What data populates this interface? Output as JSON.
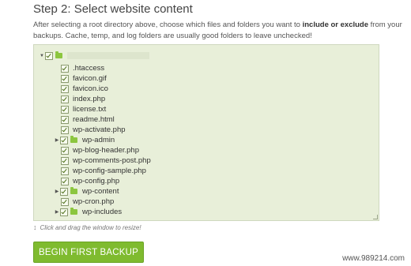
{
  "heading": "Step 2: Select website content",
  "description": {
    "part1": "After selecting a root directory above, choose which files and folders you want to ",
    "bold": "include or exclude",
    "part2": " from your backups. Cache, temp, and log folders are usually good folders to leave unchecked!"
  },
  "tree": {
    "root": {
      "expanded": true,
      "checked": true
    },
    "items": [
      {
        "name": ".htaccess",
        "type": "file",
        "checked": true
      },
      {
        "name": "favicon.gif",
        "type": "file",
        "checked": true
      },
      {
        "name": "favicon.ico",
        "type": "file",
        "checked": true
      },
      {
        "name": "index.php",
        "type": "file",
        "checked": true
      },
      {
        "name": "license.txt",
        "type": "file",
        "checked": true
      },
      {
        "name": "readme.html",
        "type": "file",
        "checked": true
      },
      {
        "name": "wp-activate.php",
        "type": "file",
        "checked": true
      },
      {
        "name": "wp-admin",
        "type": "folder",
        "checked": true
      },
      {
        "name": "wp-blog-header.php",
        "type": "file",
        "checked": true
      },
      {
        "name": "wp-comments-post.php",
        "type": "file",
        "checked": true
      },
      {
        "name": "wp-config-sample.php",
        "type": "file",
        "checked": true
      },
      {
        "name": "wp-config.php",
        "type": "file",
        "checked": true
      },
      {
        "name": "wp-content",
        "type": "folder",
        "checked": true
      },
      {
        "name": "wp-cron.php",
        "type": "file",
        "checked": true
      },
      {
        "name": "wp-includes",
        "type": "folder",
        "checked": true
      }
    ]
  },
  "resize_hint": "Click and drag the window to resize!",
  "begin_button": "BEGIN FIRST BACKUP",
  "watermark": "www.989214.com",
  "colors": {
    "tree_background": "#e8efd9",
    "folder": "#8cc63f",
    "button": "#7fbb2f"
  }
}
